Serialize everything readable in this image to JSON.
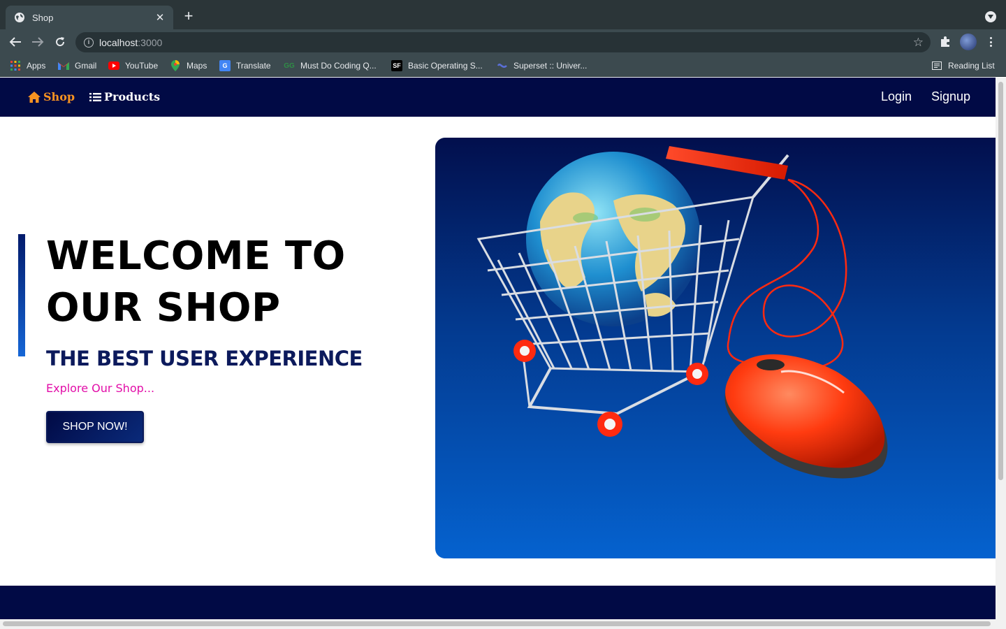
{
  "browser": {
    "tab": {
      "title": "Shop",
      "favicon": "globe-icon"
    },
    "address": {
      "host": "localhost",
      "port": ":3000"
    },
    "bookmarks": [
      {
        "label": "Apps",
        "icon": "apps-grid-icon"
      },
      {
        "label": "Gmail",
        "icon": "gmail-icon"
      },
      {
        "label": "YouTube",
        "icon": "youtube-icon"
      },
      {
        "label": "Maps",
        "icon": "maps-icon"
      },
      {
        "label": "Translate",
        "icon": "translate-icon"
      },
      {
        "label": "Must Do Coding Q...",
        "icon": "gfg-icon"
      },
      {
        "label": "Basic Operating S...",
        "icon": "sf-icon"
      },
      {
        "label": "Superset :: Univer...",
        "icon": "superset-icon"
      }
    ],
    "reading_list": "Reading List"
  },
  "site": {
    "nav": {
      "brand": "Shop",
      "products": "Products",
      "login": "Login",
      "signup": "Signup"
    },
    "hero": {
      "title_line1": "WELCOME TO",
      "title_line2": "OUR SHOP",
      "subtitle": "THE BEST USER EXPERIENCE",
      "tagline": "Explore Our Shop...",
      "button": "SHOP NOW!",
      "image": "shopping-cart-globe-mouse-illustration"
    }
  },
  "colors": {
    "navbar": "#010a45",
    "brand": "#f79321",
    "tagline": "#e20ea8",
    "subtitle": "#0c1a5c",
    "panel_top": "#020f4d",
    "panel_bottom": "#0562cf"
  }
}
